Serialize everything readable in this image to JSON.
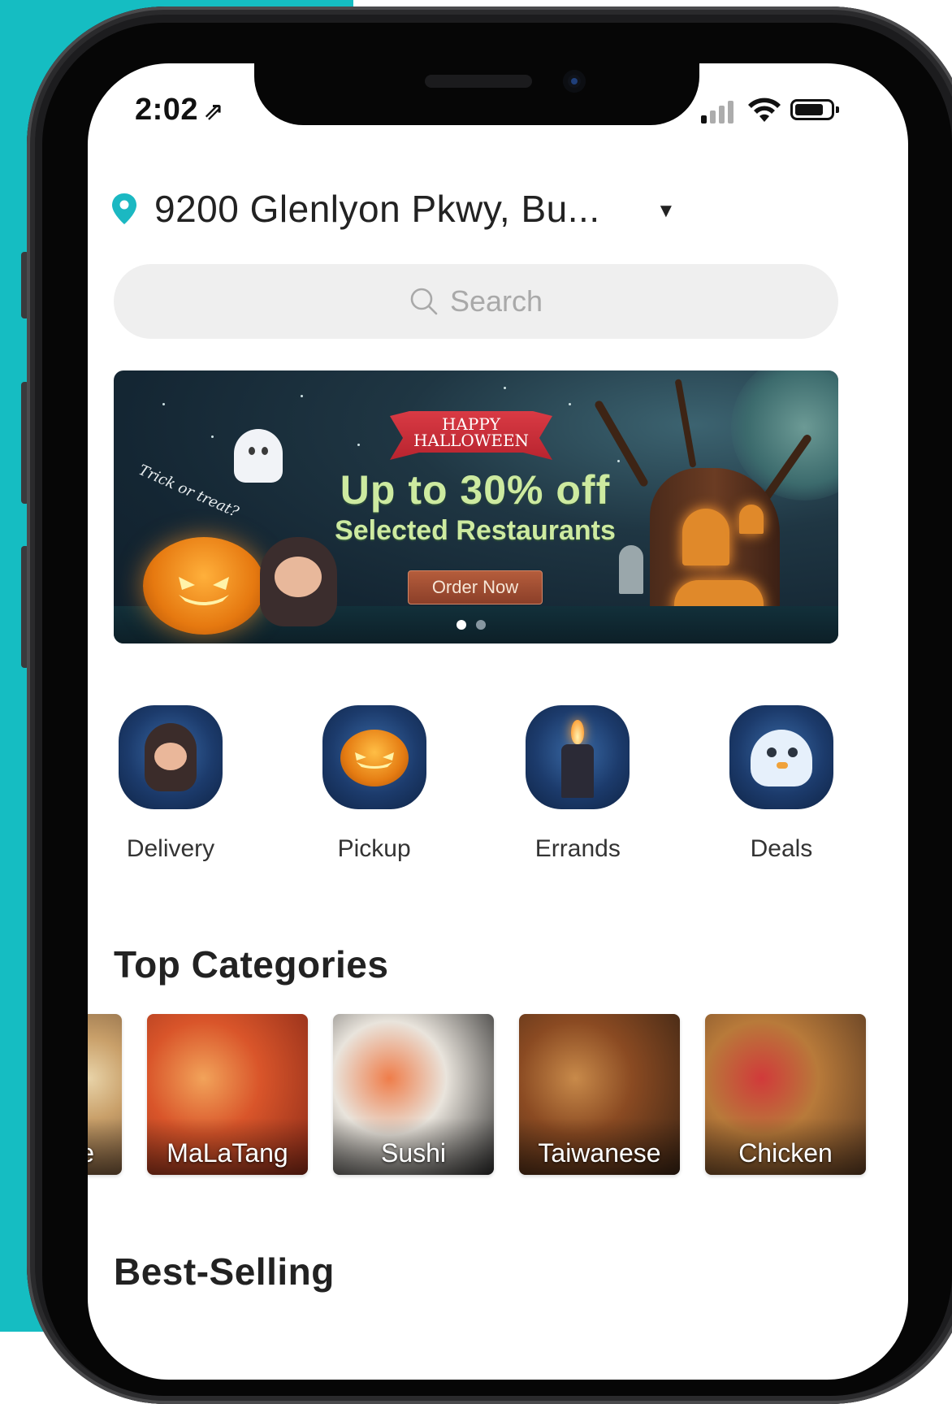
{
  "status": {
    "time": "2:02",
    "location_arrow": "⇗"
  },
  "header": {
    "address": "9200 Glenlyon Pkwy, Bu...",
    "dropdown_icon": "▼"
  },
  "search": {
    "placeholder": "Search"
  },
  "banner": {
    "ribbon": "HAPPY HALLOWEEN",
    "tagline": "Trick or treat?",
    "headline": "Up to 30% off",
    "subline": "Selected Restaurants",
    "cta": "Order Now",
    "slides": 2,
    "active_slide": 1
  },
  "services": [
    {
      "label": "Delivery",
      "icon": "hooded-kid-icon"
    },
    {
      "label": "Pickup",
      "icon": "pumpkin-icon"
    },
    {
      "label": "Errands",
      "icon": "candle-icon"
    },
    {
      "label": "Deals",
      "icon": "ghost-bird-icon"
    }
  ],
  "sections": {
    "top_categories": "Top Categories",
    "best_selling": "Best-Selling"
  },
  "categories": [
    {
      "label": "e",
      "colors": [
        "#7a5a3c",
        "#c9a06a",
        "#e8d3a8"
      ]
    },
    {
      "label": "MaLaTang",
      "colors": [
        "#8a2a18",
        "#d9552a",
        "#f2a35a"
      ]
    },
    {
      "label": "Sushi",
      "colors": [
        "#2a2a2a",
        "#e9e4dc",
        "#ef7d4a"
      ]
    },
    {
      "label": "Taiwanese",
      "colors": [
        "#3a2414",
        "#8a4a22",
        "#c88a4a"
      ]
    },
    {
      "label": "Chicken",
      "colors": [
        "#5a3a22",
        "#b87a3a",
        "#d13a3a"
      ]
    }
  ],
  "colors": {
    "teal": "#15bdc2",
    "pin": "#1bb8c2"
  }
}
